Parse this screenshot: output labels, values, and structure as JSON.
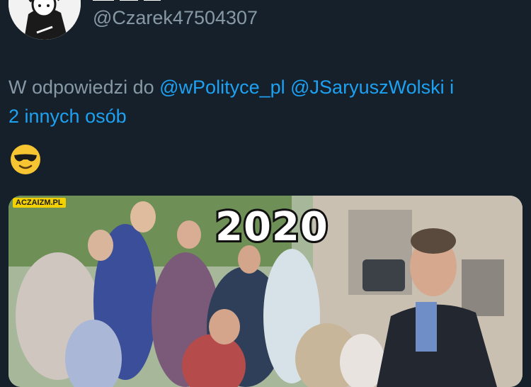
{
  "tweet": {
    "handle": "@Czarek47504307",
    "reply_prefix": "W odpowiedzi do",
    "mentions": [
      "@wPolityce_pl",
      "@JSaryuszWolski"
    ],
    "mention_joiner": "i",
    "others": "2 innych osób",
    "emoji": "smiling-face-with-sunglasses"
  },
  "media": {
    "watermark": "ACZAIZM.PL",
    "caption": "2020"
  },
  "colors": {
    "background": "#15202b",
    "secondary_text": "#8899a6",
    "link": "#1da1f2",
    "caption_text": "#ffffff"
  }
}
